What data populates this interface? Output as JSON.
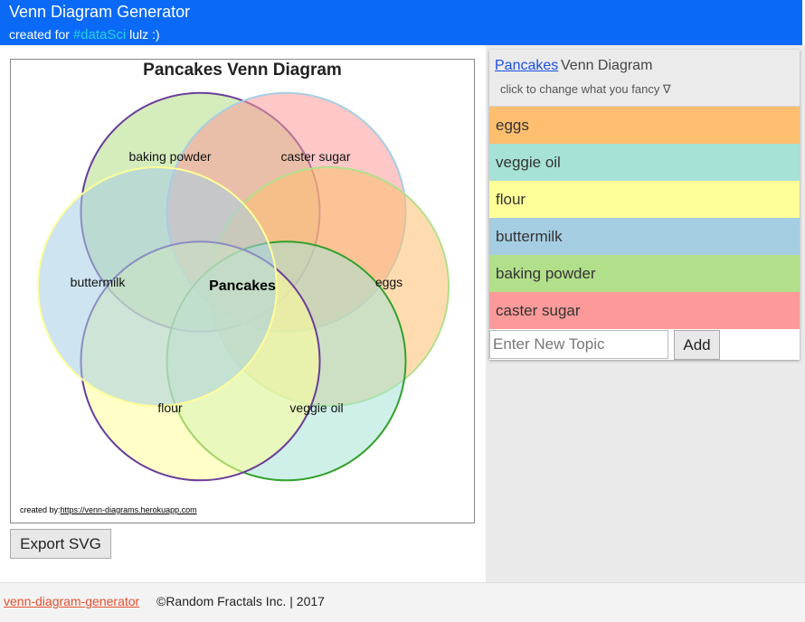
{
  "header": {
    "title": "Venn Diagram Generator",
    "subtitle_prefix": "created for",
    "subtitle_hashtag": "#dataSci",
    "subtitle_suffix": "lulz :)",
    "background_color": "#0a6af7",
    "hashtag_color": "#21d4e8"
  },
  "diagram": {
    "title": "Pancakes Venn Diagram",
    "center_label": "Pancakes",
    "credit_prefix": "created by:",
    "credit_link": "https://venn-diagrams.herokuapp.com",
    "sets": [
      {
        "label": "baking powder",
        "fill": "#b2dd87",
        "stroke": "#6a3d9a"
      },
      {
        "label": "caster sugar",
        "fill": "#fb9a99",
        "stroke": "#a6cee3"
      },
      {
        "label": "eggs",
        "fill": "#fdbf6f",
        "stroke": "#b2df8a"
      },
      {
        "label": "veggie oil",
        "fill": "#a6e3d6",
        "stroke": "#33a02c"
      },
      {
        "label": "flour",
        "fill": "#ffff99",
        "stroke": "#6a3d9a"
      },
      {
        "label": "buttermilk",
        "fill": "#a6cee3",
        "stroke": "#ffff99"
      }
    ]
  },
  "export_button": "Export SVG",
  "sidebar": {
    "topic_link": "Pancakes",
    "topic_suffix": "Venn Diagram",
    "hint": "click to change what you fancy ∇",
    "items": [
      {
        "label": "eggs",
        "color": "#fdbf6f"
      },
      {
        "label": "veggie oil",
        "color": "#a6e3d6"
      },
      {
        "label": "flour",
        "color": "#ffff99"
      },
      {
        "label": "buttermilk",
        "color": "#a6cee3"
      },
      {
        "label": "baking powder",
        "color": "#b2df8a"
      },
      {
        "label": "caster sugar",
        "color": "#fb9a99"
      }
    ],
    "new_topic_placeholder": "Enter New Topic",
    "add_button": "Add"
  },
  "footer": {
    "link": "venn-diagram-generator",
    "text": "©Random Fractals Inc. | 2017"
  }
}
